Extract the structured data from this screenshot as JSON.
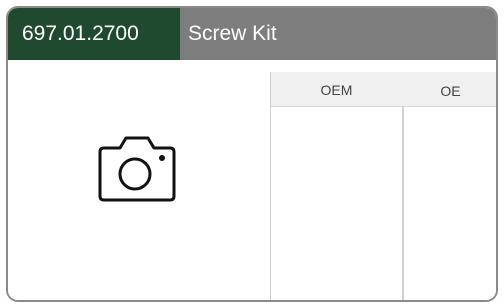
{
  "product": {
    "part_number": "697.01.2700",
    "name": "Screw Kit"
  },
  "image": {
    "placeholder_icon": "camera-icon"
  },
  "references": {
    "columns": [
      {
        "label": "OEM",
        "values": []
      },
      {
        "label": "OE",
        "values": []
      }
    ]
  },
  "colors": {
    "header_gray": "#7d7d7d",
    "part_number_green": "#1f4a30",
    "border": "#8a8a8a",
    "table_header_bg": "#f0f0f0"
  }
}
